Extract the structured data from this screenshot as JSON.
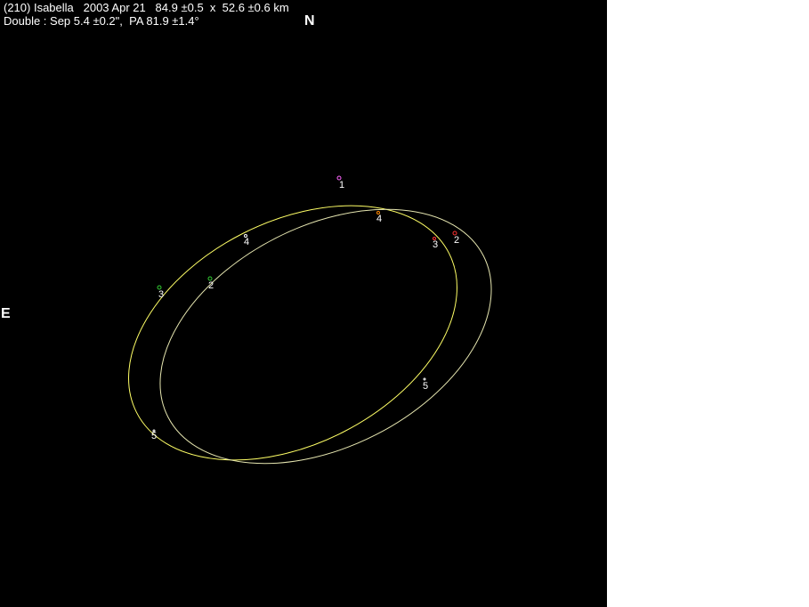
{
  "header": {
    "line1": "(210) Isabella   2003 Apr 21   84.9 ±0.5  x  52.6 ±0.6 km",
    "line2": "Double : Sep 5.4 ±0.2\",  PA 81.9 ±1.4°"
  },
  "compass": {
    "north": "N",
    "east": "E"
  },
  "colors": {
    "background": "#000000",
    "ellipse": "#ffff66",
    "ellipse_secondary": "#e6e6b0",
    "label": "#ffffff",
    "chord_1": "#ff66ff",
    "chord_2": "#ff3333",
    "chord_3": "#33cc33",
    "chord_4": "#ff8800",
    "chord_5": "#ffffff"
  },
  "markers": [
    {
      "id": "1",
      "label": "1",
      "color_key": "chord_1"
    },
    {
      "id": "2a",
      "label": "2",
      "color_key": "chord_2"
    },
    {
      "id": "3a",
      "label": "3",
      "color_key": "chord_2"
    },
    {
      "id": "4a",
      "label": "4",
      "color_key": "chord_4"
    },
    {
      "id": "4b",
      "label": "4",
      "color_key": "chord_5"
    },
    {
      "id": "3b",
      "label": "3",
      "color_key": "chord_3"
    },
    {
      "id": "2b",
      "label": "2",
      "color_key": "chord_3"
    },
    {
      "id": "5a",
      "label": "5",
      "color_key": "chord_5"
    },
    {
      "id": "5b",
      "label": "5",
      "color_key": "chord_5"
    }
  ]
}
